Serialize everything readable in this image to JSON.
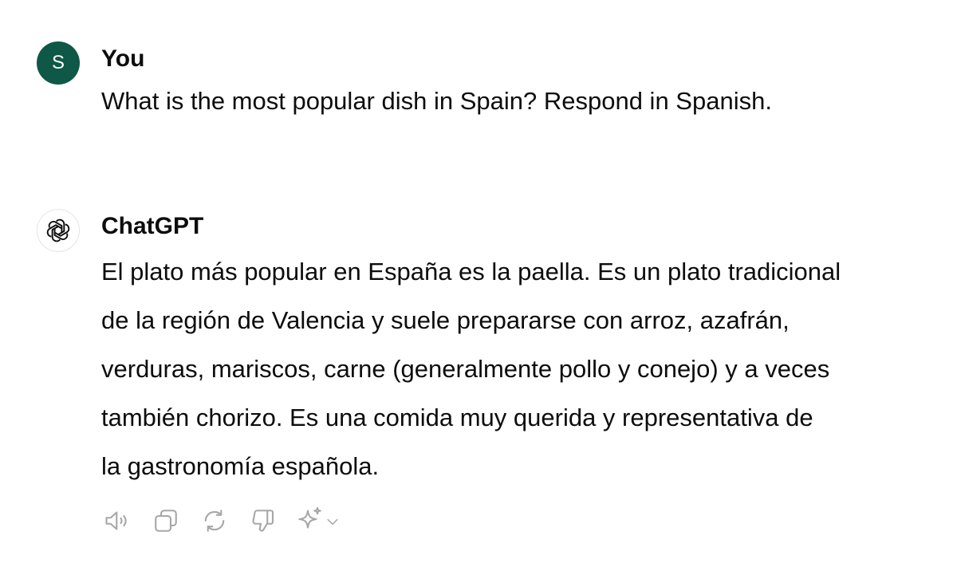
{
  "conversation": {
    "user": {
      "avatar_initial": "S",
      "avatar_color": "#0f5746",
      "name": "You",
      "message": "What is the most popular dish in Spain? Respond in Spanish."
    },
    "assistant": {
      "avatar_icon": "openai-logo-icon",
      "name": "ChatGPT",
      "lines": [
        "El plato más popular en España es la paella. Es un plato tradicional",
        "de la región de Valencia y suele prepararse con arroz, azafrán,",
        "verduras, mariscos, carne (generalmente pollo y conejo) y a veces",
        "también chorizo. Es una comida muy querida y representativa de",
        "la gastronomía española."
      ]
    }
  },
  "actions": {
    "icons": [
      "speaker-icon",
      "copy-icon",
      "regenerate-icon",
      "thumbs-down-icon",
      "sparkle-icon",
      "chevron-down-icon"
    ],
    "icon_color": "#a7a7a7"
  }
}
